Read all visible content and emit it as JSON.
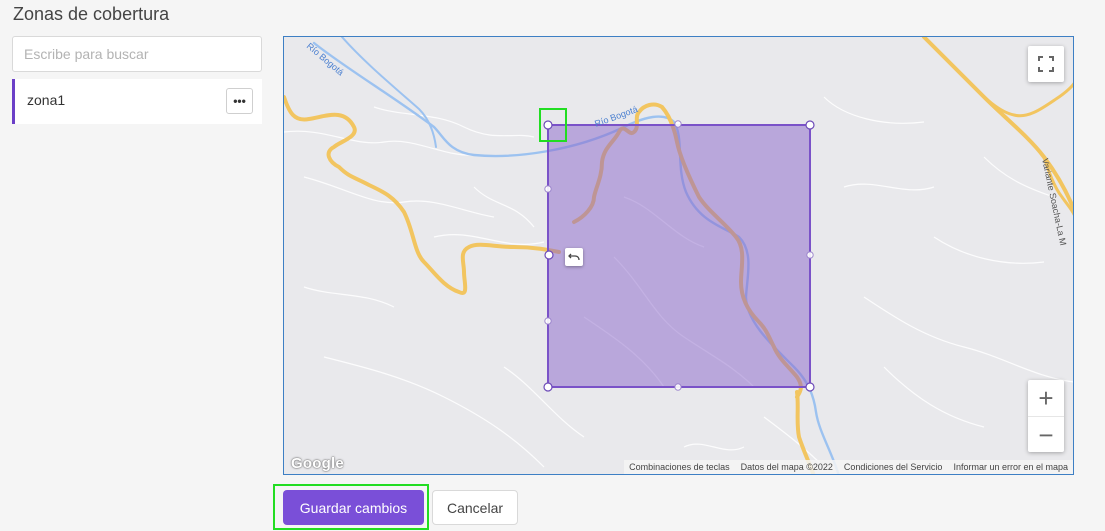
{
  "page": {
    "title": "Zonas de cobertura"
  },
  "search": {
    "placeholder": "Escribe para buscar",
    "value": ""
  },
  "zones": [
    {
      "name": "zona1",
      "menu_icon": "ellipsis-icon",
      "menu_label": "•••"
    }
  ],
  "map": {
    "labels": {
      "river_upper_left": "Río Bogotá",
      "river_center": "Río Bogotá",
      "road_right": "Variante Soacha-La M"
    },
    "google_logo": "Google",
    "attribution": [
      "Combinaciones de teclas",
      "Datos del mapa ©2022",
      "Condiciones del Servicio",
      "Informar un error en el mapa"
    ],
    "zoom_in_label": "+",
    "zoom_out_label": "−",
    "polygon_color": "#8a66c9",
    "road_color": "#f7c85a",
    "river_color": "#8fb9ee",
    "icons": {
      "fullscreen": "fullscreen-icon",
      "undo": "undo-icon"
    }
  },
  "actions": {
    "save_label": "Guardar cambios",
    "cancel_label": "Cancelar"
  },
  "colors": {
    "accent": "#7a4fd8",
    "highlight": "#22dd22"
  }
}
